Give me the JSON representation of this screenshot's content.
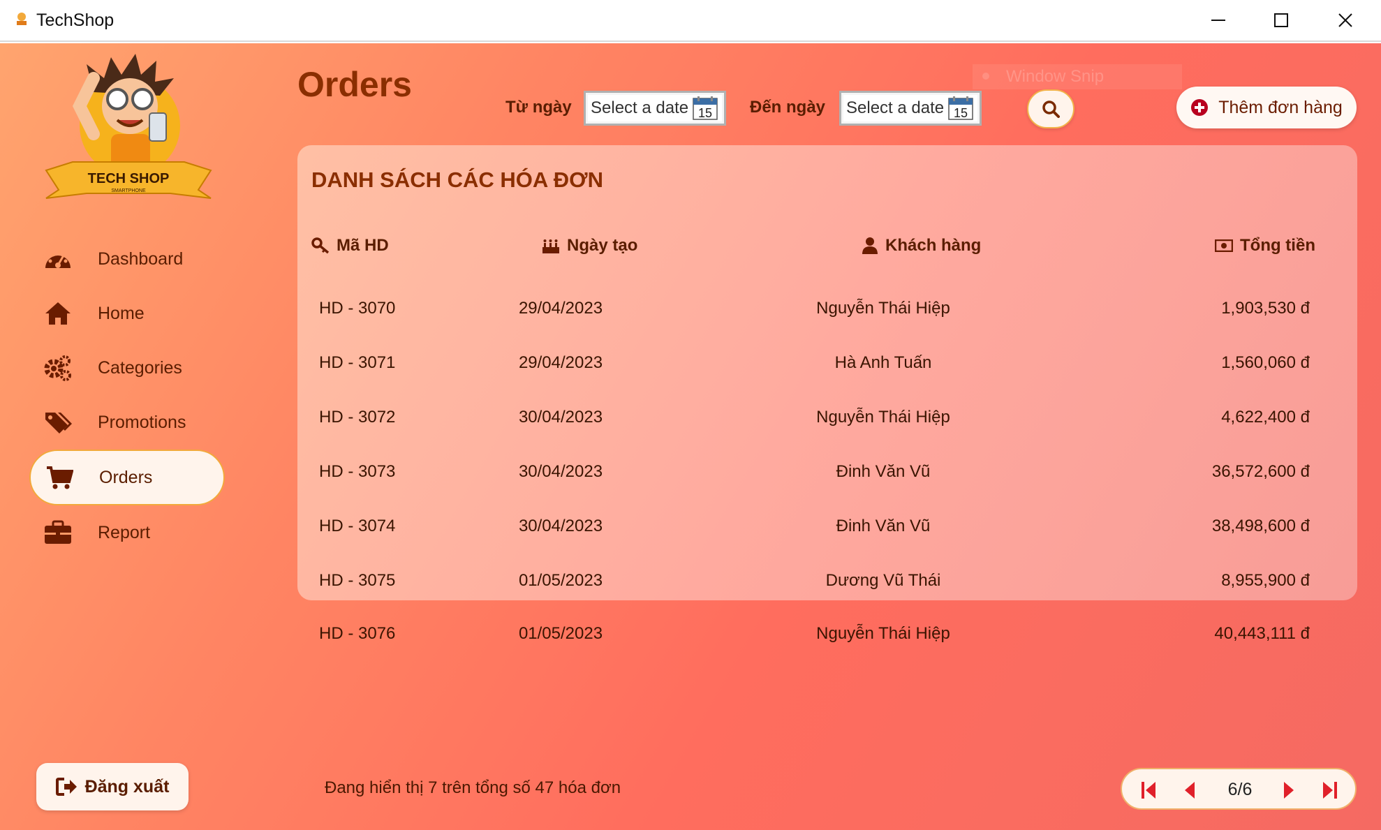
{
  "window": {
    "title": "TechShop"
  },
  "logo": {
    "text": "TECH SHOP",
    "subtext": "SMARTPHONE"
  },
  "sidebar": {
    "items": [
      {
        "label": "Dashboard",
        "icon": "dashboard-gauge-icon",
        "active": false
      },
      {
        "label": "Home",
        "icon": "home-icon",
        "active": false
      },
      {
        "label": "Categories",
        "icon": "gears-icon",
        "active": false
      },
      {
        "label": "Promotions",
        "icon": "tags-icon",
        "active": false
      },
      {
        "label": "Orders",
        "icon": "cart-icon",
        "active": true
      },
      {
        "label": "Report",
        "icon": "briefcase-icon",
        "active": false
      }
    ],
    "logout_label": "Đăng xuất"
  },
  "header": {
    "title": "Orders",
    "from_label": "Từ ngày",
    "to_label": "Đến ngày",
    "from_date": "Select a date",
    "to_date": "Select a date",
    "calendar_day": "15",
    "add_label": "Thêm đơn hàng",
    "snip_label": "Window Snip"
  },
  "table": {
    "title": "DANH SÁCH CÁC HÓA ĐƠN",
    "columns": [
      "Mã HD",
      "Ngày tạo",
      "Khách hàng",
      "Tổng tiền"
    ],
    "rows": [
      {
        "id": "HD - 3070",
        "date": "29/04/2023",
        "customer": "Nguyễn Thái Hiệp",
        "total": "1,903,530 đ"
      },
      {
        "id": "HD - 3071",
        "date": "29/04/2023",
        "customer": "Hà Anh Tuấn",
        "total": "1,560,060 đ"
      },
      {
        "id": "HD - 3072",
        "date": "30/04/2023",
        "customer": "Nguyễn Thái Hiệp",
        "total": "4,622,400 đ"
      },
      {
        "id": "HD - 3073",
        "date": "30/04/2023",
        "customer": "Đinh Văn Vũ",
        "total": "36,572,600 đ"
      },
      {
        "id": "HD - 3074",
        "date": "30/04/2023",
        "customer": "Đinh Văn Vũ",
        "total": "38,498,600 đ"
      },
      {
        "id": "HD - 3075",
        "date": "01/05/2023",
        "customer": "Dương Vũ Thái",
        "total": "8,955,900 đ"
      },
      {
        "id": "HD - 3076",
        "date": "01/05/2023",
        "customer": "Nguyễn Thái Hiệp",
        "total": "40,443,111 đ"
      }
    ]
  },
  "footer": {
    "status": "Đang hiển thị 7 trên tổng số 47 hóa đơn",
    "page": "6/6"
  },
  "colors": {
    "accent": "#8a2e00",
    "pager_red": "#e0202a",
    "bg_start": "#ffa46e",
    "bg_end": "#f56a62"
  }
}
